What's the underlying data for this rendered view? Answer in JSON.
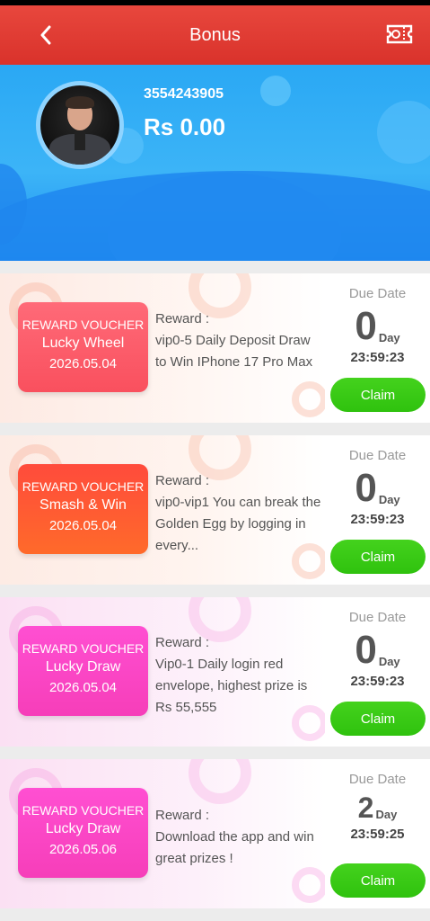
{
  "header": {
    "title": "Bonus",
    "back_icon": "chevron-left-icon",
    "ticket_icon": "ticket-icon"
  },
  "profile": {
    "user_id": "3554243905",
    "balance": "Rs 0.00"
  },
  "vouchers": [
    {
      "tag": "REWARD VOUCHER",
      "name": "Lucky Wheel",
      "date": "2026.05.04",
      "reward_label": "Reward :",
      "reward_text": "vip0-5 Daily Deposit Draw to Win IPhone 17 Pro Max",
      "due_label": "Due Date",
      "days": "0",
      "day_unit": "Day",
      "time": "23:59:23",
      "claim_label": "Claim",
      "color": "#f9505e"
    },
    {
      "tag": "REWARD VOUCHER",
      "name": "Smash & Win",
      "date": "2026.05.04",
      "reward_label": "Reward :",
      "reward_text": "vip0-vip1 You can break the Golden Egg by logging in every...",
      "due_label": "Due Date",
      "days": "0",
      "day_unit": "Day",
      "time": "23:59:23",
      "claim_label": "Claim",
      "color": "#ff5a33"
    },
    {
      "tag": "REWARD VOUCHER",
      "name": "Lucky Draw",
      "date": "2026.05.04",
      "reward_label": "Reward :",
      "reward_text": "Vip0-1 Daily login red envelope, highest prize is Rs 55,555",
      "due_label": "Due Date",
      "days": "0",
      "day_unit": "Day",
      "time": "23:59:23",
      "claim_label": "Claim",
      "color": "#f63eb9"
    },
    {
      "tag": "REWARD VOUCHER",
      "name": "Lucky Draw",
      "date": "2026.05.06",
      "reward_label": "Reward :",
      "reward_text": "Download the app and win great prizes !",
      "due_label": "Due Date",
      "days": "2",
      "day_unit": "Day",
      "time": "23:59:25",
      "claim_label": "Claim",
      "color": "#f63eb9"
    }
  ],
  "colors": {
    "header": "#e03a32",
    "hero": "#2aa8f4",
    "claim": "#3ac814"
  }
}
